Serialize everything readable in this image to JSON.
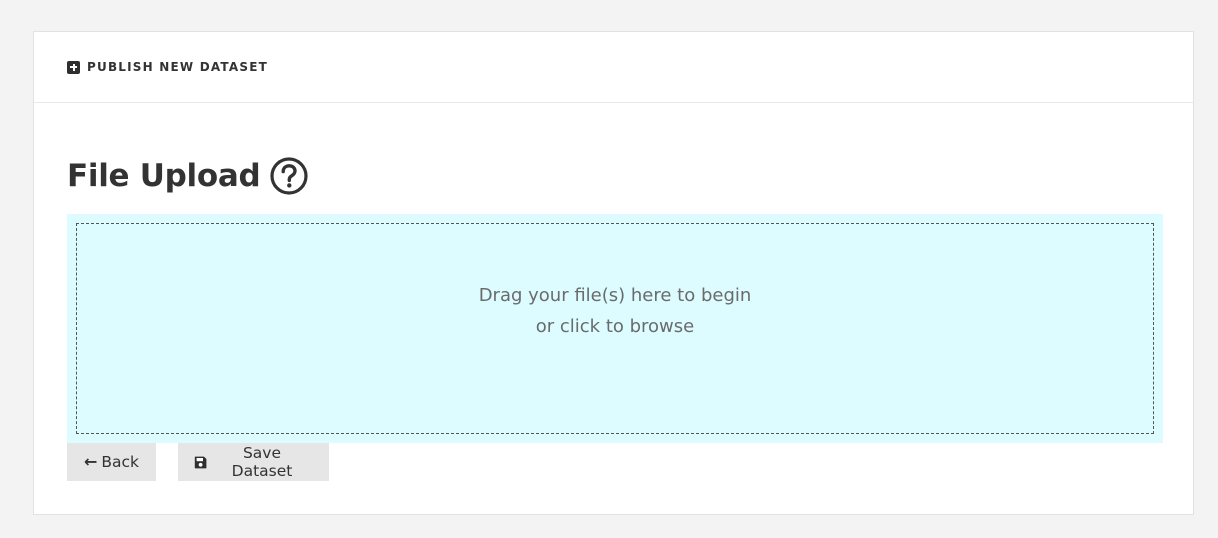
{
  "header": {
    "title": "PUBLISH NEW DATASET",
    "icon": "plus-square-icon"
  },
  "page": {
    "title": "File Upload",
    "help_icon": "question-circle-icon"
  },
  "dropzone": {
    "line1": "Drag your file(s) here to begin",
    "line2": "or click to browse",
    "background": "#dcfcff"
  },
  "buttons": {
    "back_label": "Back",
    "back_icon": "arrow-left-icon",
    "save_label": "Save Dataset",
    "save_icon": "floppy-disk-icon"
  }
}
